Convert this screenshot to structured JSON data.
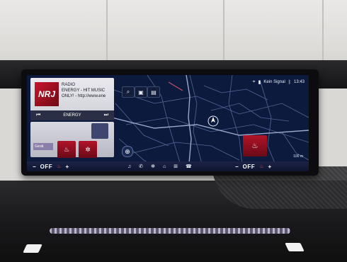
{
  "status": {
    "location_icon": "location-pin-icon",
    "signal_text": "Kein Signal",
    "time": "13:43"
  },
  "media": {
    "station_logo": "NRJ",
    "line1": "RADIO",
    "line2": "ENERGY - HIT MUSIC",
    "line3": "ONLY! - http://www.ene",
    "station": "ENERGY"
  },
  "climate": {
    "driver_temp": "OFF",
    "passenger_temp": "OFF",
    "minus": "−",
    "plus": "+",
    "tag_label": "Gerät"
  },
  "map": {
    "scale_label": "100 m"
  },
  "icons": {
    "search": "search-icon",
    "nav_media": "music-icon",
    "nav_phone": "phone-icon",
    "nav_home": "home-icon",
    "nav_apps": "apps-icon",
    "nav_fan": "fan-icon"
  }
}
